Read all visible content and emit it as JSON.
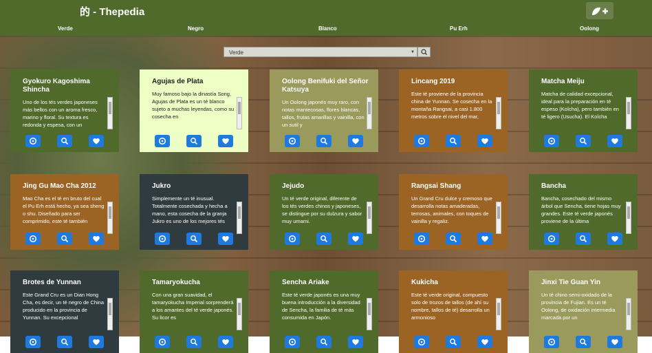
{
  "header": {
    "title": "的 - Thepedia",
    "add_label": "🍃✚"
  },
  "nav": [
    "Verde",
    "Negro",
    "Blanco",
    "Pu Erh",
    "Oolong"
  ],
  "filter": {
    "selected": "Verde"
  },
  "cards": [
    {
      "title": "Gyokuro Kagoshima Shincha",
      "text": "Uno de los tés verdes japoneses más bellos con un aroma fresco, marino y floral. Su textura es redonda y espesa, con un",
      "theme": "green"
    },
    {
      "title": "Agujas de Plata",
      "text": "Muy famoso bajo la dinastía Song, Agujas de Plata es un té blanco sujeto a muchas leyendas, como su cosecha en",
      "theme": "light"
    },
    {
      "title": "Oolong Benifuki del Señor Katsuya",
      "text": "Un Oolong japonés muy raro, con notas mantecosas, flores blancas, tallos, frutas amarillas y vainilla, con un sutil y",
      "theme": "olive"
    },
    {
      "title": "Lincang 2019",
      "text": "Este té proviene de la provincia china de Yunnan. Se cosecha en la montaña Rangsai, a casi 1.800 metros sobre el nivel del mar,",
      "theme": "brown"
    },
    {
      "title": "Matcha Meiju",
      "text": "Matcha de calidad excepcional, ideal para la preparación en té espeso (Koîcha), pero también en té ligero (Usucha). El Koîcha",
      "theme": "green"
    },
    {
      "title": "Jing Gu Mao Cha 2012",
      "text": "Mao Cha es el té en bruto del cual el Pu Erh está hecho, ya sea sheng o shu. Diseñado para ser comprimido, este té también",
      "theme": "brown"
    },
    {
      "title": "Jukro",
      "text": "Simplemente un té inusual. Totalmente cosechada y hecha a mano, esta cosecha de la granja Jukro es uno de los mejores tés",
      "theme": "slate"
    },
    {
      "title": "Jejudo",
      "text": "Un té verde original, diferente de los tés verdes chinos y japoneses, se distingue por su dulzura y sabor muy umami.",
      "theme": "green"
    },
    {
      "title": "Rangsai Shang",
      "text": "Un Grand Cru dulce y cremoso que desarrolla notas amaderadas, terrosas, animales, con toques de vainilla y regaliz.",
      "theme": "brown"
    },
    {
      "title": "Bancha",
      "text": "Bancha, cosechado del mismo árbol que Sencha, tiene hojas muy grandes. Este té verde japonés proviene de la última",
      "theme": "green"
    },
    {
      "title": "Brotes de Yunnan",
      "text": "Este Grand Cru es un Dian Hong Cha, es decir, un té negro de China producido en la provincia de Yunnan. Su excepcional",
      "theme": "slate"
    },
    {
      "title": "Tamaryokucha",
      "text": "Con una gran suavidad, el tamaryokucha Imperial sorprenderá a los amantes del té verde japonés. Su licor es",
      "theme": "green"
    },
    {
      "title": "Sencha Ariake",
      "text": "Este té verde japonés es una muy buena introducción a la diversidad de Sencha, la familia de té más consumida en Japón.",
      "theme": "green"
    },
    {
      "title": "Kukicha",
      "text": "Este té verde original, compuesto solo de trozos de tallos (de ahí su nombre, tallos de té) desarrolla un armonioso",
      "theme": "brown"
    },
    {
      "title": "Jinxi Tie Guan Yin",
      "text": "Un té chino semi-oxidado de la provincia de Fujian. Es un té Oolong, de oxidación intermedia marcada por un",
      "theme": "olive"
    }
  ]
}
